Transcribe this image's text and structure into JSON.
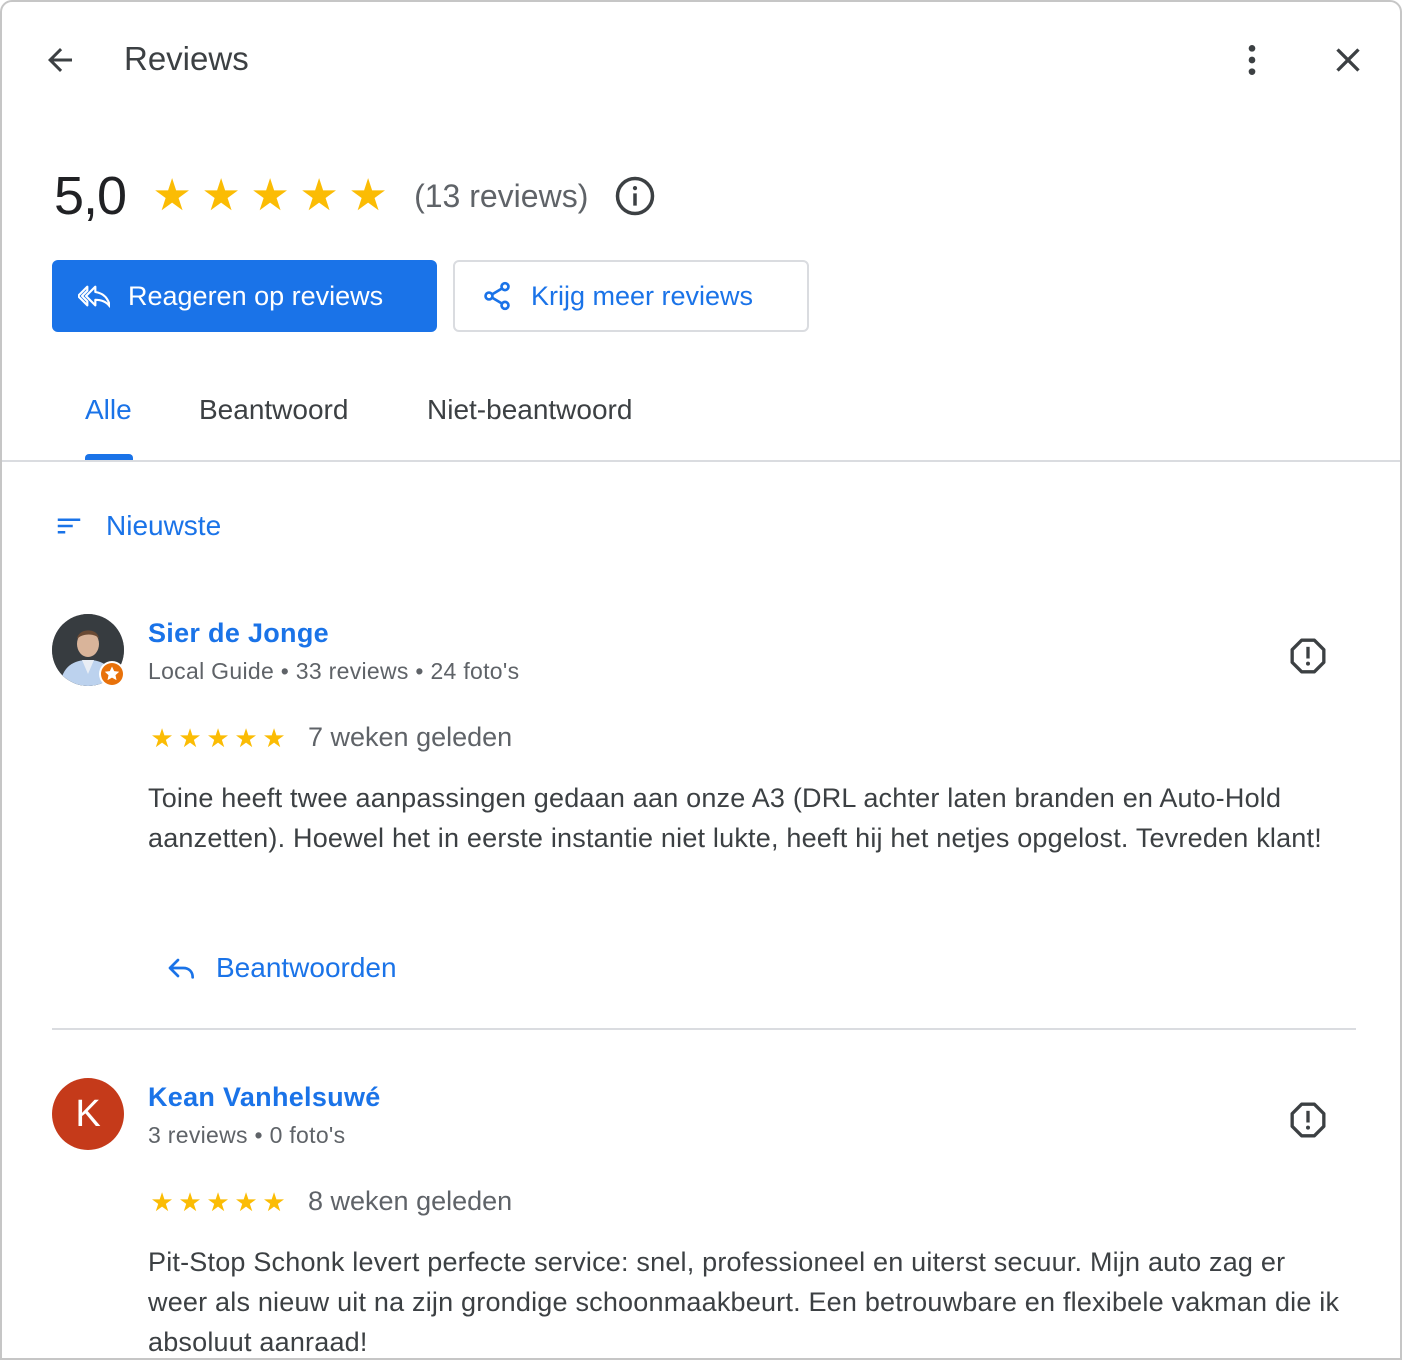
{
  "header": {
    "title": "Reviews",
    "back_icon": "arrow-back-icon",
    "more_icon": "more-vert-icon",
    "close_icon": "close-icon"
  },
  "summary": {
    "score": "5,0",
    "rating": 5,
    "stars": [
      "★",
      "★",
      "★",
      "★",
      "★"
    ],
    "count_text": "(13 reviews)",
    "info_icon": "info-icon"
  },
  "actions": {
    "respond_label": "Reageren op reviews",
    "get_more_label": "Krijg meer reviews"
  },
  "tabs": [
    {
      "label": "Alle",
      "active": true
    },
    {
      "label": "Beantwoord",
      "active": false
    },
    {
      "label": "Niet-beantwoord",
      "active": false
    }
  ],
  "sort": {
    "label": "Nieuwste"
  },
  "reviews": [
    {
      "author": "Sier de Jonge",
      "meta": "Local Guide • 33 reviews • 24 foto's",
      "rating": 5,
      "stars": "★★★★★",
      "time": "7 weken geleden",
      "text": "Toine heeft twee aanpassingen gedaan aan onze A3 (DRL achter laten branden en Auto-Hold aanzetten). Hoewel het in eerste instantie niet lukte, heeft hij het netjes opgelost. Tevreden klant!",
      "reply_label": "Beantwoorden"
    },
    {
      "author": "Kean Vanhelsuwé",
      "avatar_letter": "K",
      "meta": "3 reviews • 0 foto's",
      "rating": 5,
      "stars": "★★★★★",
      "time": "8 weken geleden",
      "text": "Pit-Stop Schonk levert perfecte service: snel, professioneel en uiterst secuur. Mijn auto zag er weer als nieuw uit na zijn grondige schoonmaakbeurt. Een betrouwbare en flexibele vakman die ik absoluut aanraad!"
    }
  ],
  "colors": {
    "accent": "#1a73e8",
    "star": "#fbbc04",
    "avatar_k": "#c53a1a",
    "local_guide_badge": "#e8710a"
  }
}
